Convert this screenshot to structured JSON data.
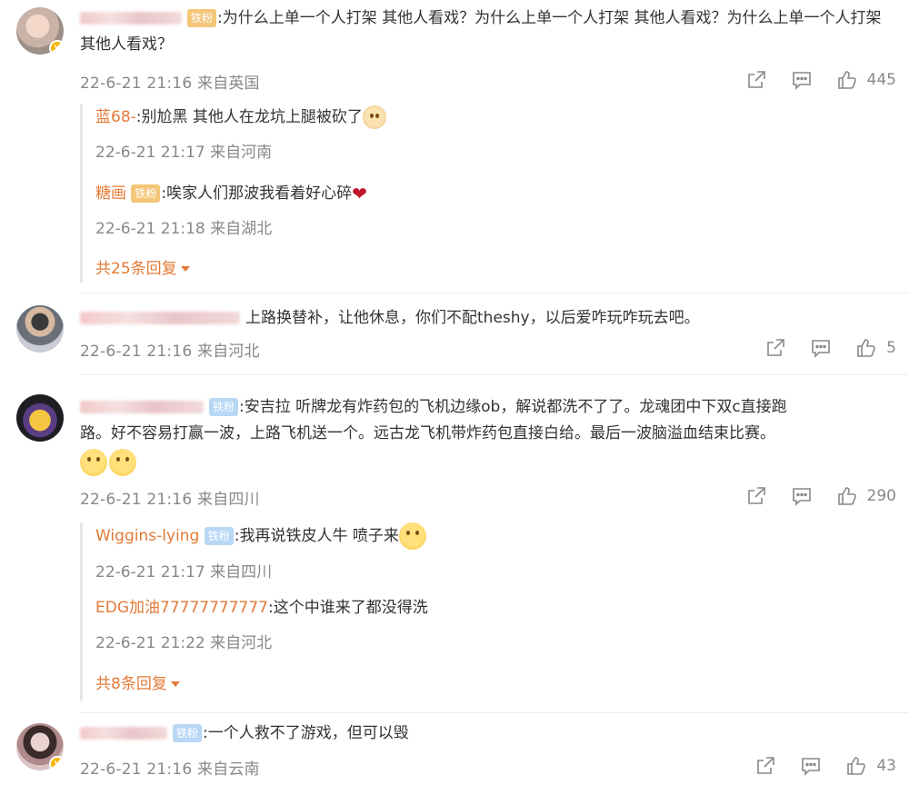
{
  "comments": [
    {
      "badge": "铁粉",
      "text": ":为什么上单一个人打架 其他人看戏？为什么上单一个人打架 其他人看戏？为什么上单一个人打架 其他人看戏？",
      "date": "22-6-21 21:16 来自英国",
      "likes": "445",
      "replies": [
        {
          "name": "蓝68-",
          "text": ":别尬黑 其他人在龙坑上腿被砍了",
          "date": "22-6-21 21:17 来自河南"
        },
        {
          "name": "糖画",
          "badge": "铁粉",
          "text": ":唉家人们那波我看着好心碎",
          "date": "22-6-21 21:18 来自湖北"
        }
      ],
      "more": "共25条回复"
    },
    {
      "text": "上路换替补，让他休息，你们不配theshy，以后爱咋玩咋玩去吧。",
      "date": "22-6-21 21:16 来自河北",
      "likes": "5"
    },
    {
      "badge": "铁粉",
      "text_line1": ":安吉拉 听牌龙有炸药包的飞机边缘ob，解说都洗不了了。龙魂团中下双c直接跑",
      "text_line2": "路。好不容易打赢一波，上路飞机送一个。远古龙飞机带炸药包直接白给。最后一波脑溢血结束比赛。",
      "date": "22-6-21 21:16 来自四川",
      "likes": "290",
      "replies": [
        {
          "name": "Wiggins-lying",
          "badge": "铁粉",
          "text": ":我再说铁皮人牛 喷子来",
          "date": "22-6-21 21:17 来自四川"
        },
        {
          "name": "EDG加油77777777777",
          "text": ":这个中谁来了都没得洗",
          "date": "22-6-21 21:22 来自河北"
        }
      ],
      "more": "共8条回复"
    },
    {
      "badge": "铁粉",
      "text": ":一个人救不了游戏，但可以毁",
      "date": "22-6-21 21:16 来自云南",
      "likes": "43"
    }
  ],
  "icons": [
    "share-icon",
    "comment-icon",
    "like-icon"
  ],
  "colors": {
    "name_orange": "#e37a37",
    "meta_gray": "#888888",
    "badge_blue": "#b8d7f5"
  }
}
